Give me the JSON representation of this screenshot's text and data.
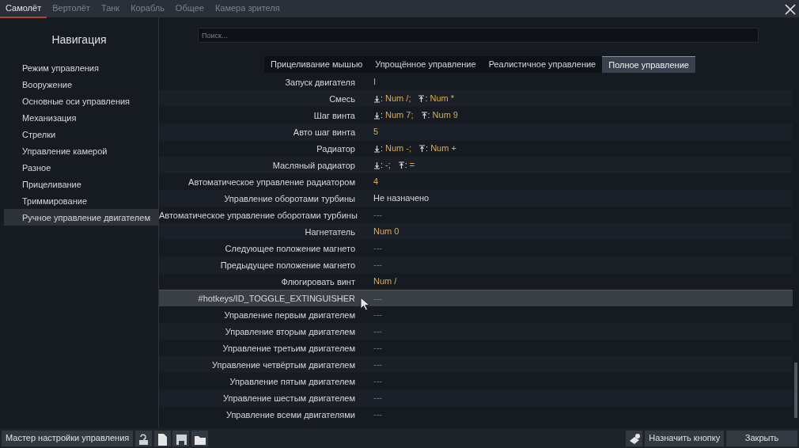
{
  "top_tabs": [
    {
      "label": "Самолёт",
      "selected": true
    },
    {
      "label": "Вертолёт",
      "selected": false
    },
    {
      "label": "Танк",
      "selected": false
    },
    {
      "label": "Корабль",
      "selected": false
    },
    {
      "label": "Общее",
      "selected": false
    },
    {
      "label": "Камера зрителя",
      "selected": false
    }
  ],
  "sidebar": {
    "title": "Навигация",
    "items": [
      {
        "label": "Режим управления",
        "selected": false
      },
      {
        "label": "Вооружение",
        "selected": false
      },
      {
        "label": "Основные оси управления",
        "selected": false
      },
      {
        "label": "Механизация",
        "selected": false
      },
      {
        "label": "Стрелки",
        "selected": false
      },
      {
        "label": "Управление камерой",
        "selected": false
      },
      {
        "label": "Разное",
        "selected": false
      },
      {
        "label": "Прицеливание",
        "selected": false
      },
      {
        "label": "Триммирование",
        "selected": false
      },
      {
        "label": "Ручное управление двигателем",
        "selected": true
      }
    ]
  },
  "search": {
    "placeholder": "Поиск..."
  },
  "mode_tabs": [
    {
      "label": "Прицеливание мышью",
      "selected": false
    },
    {
      "label": "Упрощённое управление",
      "selected": false
    },
    {
      "label": "Реалистичное управление",
      "selected": false
    },
    {
      "label": "Полное управление",
      "selected": true
    }
  ],
  "rows": [
    {
      "label": "Запуск двигателя",
      "kind": "keys",
      "selected": false,
      "parts": [
        {
          "kind": "plain",
          "key": "I"
        }
      ]
    },
    {
      "label": "Смесь",
      "kind": "keys",
      "selected": false,
      "parts": [
        {
          "kind": "down",
          "sep": ":",
          "key": "Num /;"
        },
        {
          "kind": "up",
          "sep": ":",
          "key": "Num *"
        }
      ]
    },
    {
      "label": "Шаг винта",
      "kind": "keys",
      "selected": false,
      "parts": [
        {
          "kind": "down",
          "sep": ":",
          "key": "Num 7;"
        },
        {
          "kind": "up",
          "sep": ":",
          "key": "Num 9"
        }
      ]
    },
    {
      "label": "Авто шаг винта",
      "kind": "keys",
      "selected": false,
      "parts": [
        {
          "kind": "plain",
          "key": "5"
        }
      ]
    },
    {
      "label": "Радиатор",
      "kind": "keys",
      "selected": false,
      "parts": [
        {
          "kind": "down",
          "sep": ":",
          "key": "Num -;"
        },
        {
          "kind": "up",
          "sep": ":",
          "key": "Num +"
        }
      ]
    },
    {
      "label": "Масляный радиатор",
      "kind": "keys",
      "selected": false,
      "parts": [
        {
          "kind": "down",
          "sep": ":",
          "key": "-;"
        },
        {
          "kind": "up",
          "sep": ":",
          "key": "="
        }
      ]
    },
    {
      "label": "Автоматическое управление радиатором",
      "kind": "keys",
      "selected": false,
      "parts": [
        {
          "kind": "plain",
          "key": "4"
        }
      ]
    },
    {
      "label": "Управление оборотами турбины",
      "kind": "text",
      "selected": false,
      "value": "Не назначено"
    },
    {
      "label": "Автоматическое управление оборотами турбины",
      "kind": "empty",
      "selected": false,
      "value": "---"
    },
    {
      "label": "Нагнетатель",
      "kind": "keys",
      "selected": false,
      "parts": [
        {
          "kind": "plain",
          "key": "Num 0"
        }
      ]
    },
    {
      "label": "Следующее положение магнето",
      "kind": "empty",
      "selected": false,
      "value": "---"
    },
    {
      "label": "Предыдущее положение магнето",
      "kind": "empty",
      "selected": false,
      "value": "---"
    },
    {
      "label": "Флюгировать винт",
      "kind": "keys",
      "selected": false,
      "parts": [
        {
          "kind": "plain",
          "key": "Num /"
        }
      ]
    },
    {
      "label": "#hotkeys/ID_TOGGLE_EXTINGUISHER",
      "kind": "empty",
      "selected": true,
      "value": "---"
    },
    {
      "label": "Управление первым двигателем",
      "kind": "empty",
      "selected": false,
      "value": "---"
    },
    {
      "label": "Управление вторым двигателем",
      "kind": "empty",
      "selected": false,
      "value": "---"
    },
    {
      "label": "Управление третьим двигателем",
      "kind": "empty",
      "selected": false,
      "value": "---"
    },
    {
      "label": "Управление четвёртым двигателем",
      "kind": "empty",
      "selected": false,
      "value": "---"
    },
    {
      "label": "Управление пятым двигателем",
      "kind": "empty",
      "selected": false,
      "value": "---"
    },
    {
      "label": "Управление шестым двигателем",
      "kind": "empty",
      "selected": false,
      "value": "---"
    },
    {
      "label": "Управление всеми двигателями",
      "kind": "empty",
      "selected": false,
      "value": "---"
    }
  ],
  "footer": {
    "wizard_button": "Мастер настройки управления",
    "assign_button": "Назначить кнопку",
    "close_button": "Закрыть"
  }
}
